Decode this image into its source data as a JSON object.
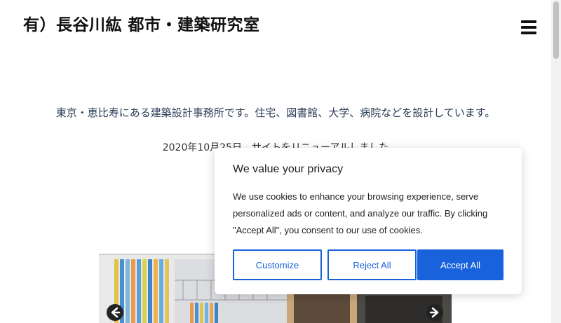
{
  "header": {
    "site_title": "有）長谷川紘 都市・建築研究室",
    "menu_icon": "hamburger-menu-icon"
  },
  "main": {
    "intro": "東京・恵比寿にある建築設計事務所です。住宅、図書館、大学、病院などを設計しています。",
    "news": "2020年10月25日　サイトをリニューアルしました"
  },
  "slider": {
    "prev_icon": "arrow-left-icon",
    "next_icon": "arrow-right-icon"
  },
  "cookie_banner": {
    "title": "We value your privacy",
    "text": "We use cookies to enhance your browsing experience, serve personalized ads or content, and analyze our traffic. By clicking \"Accept All\", you consent to our use of cookies.",
    "customize_label": "Customize",
    "reject_label": "Reject All",
    "accept_label": "Accept All",
    "accent_color": "#1863dc"
  }
}
